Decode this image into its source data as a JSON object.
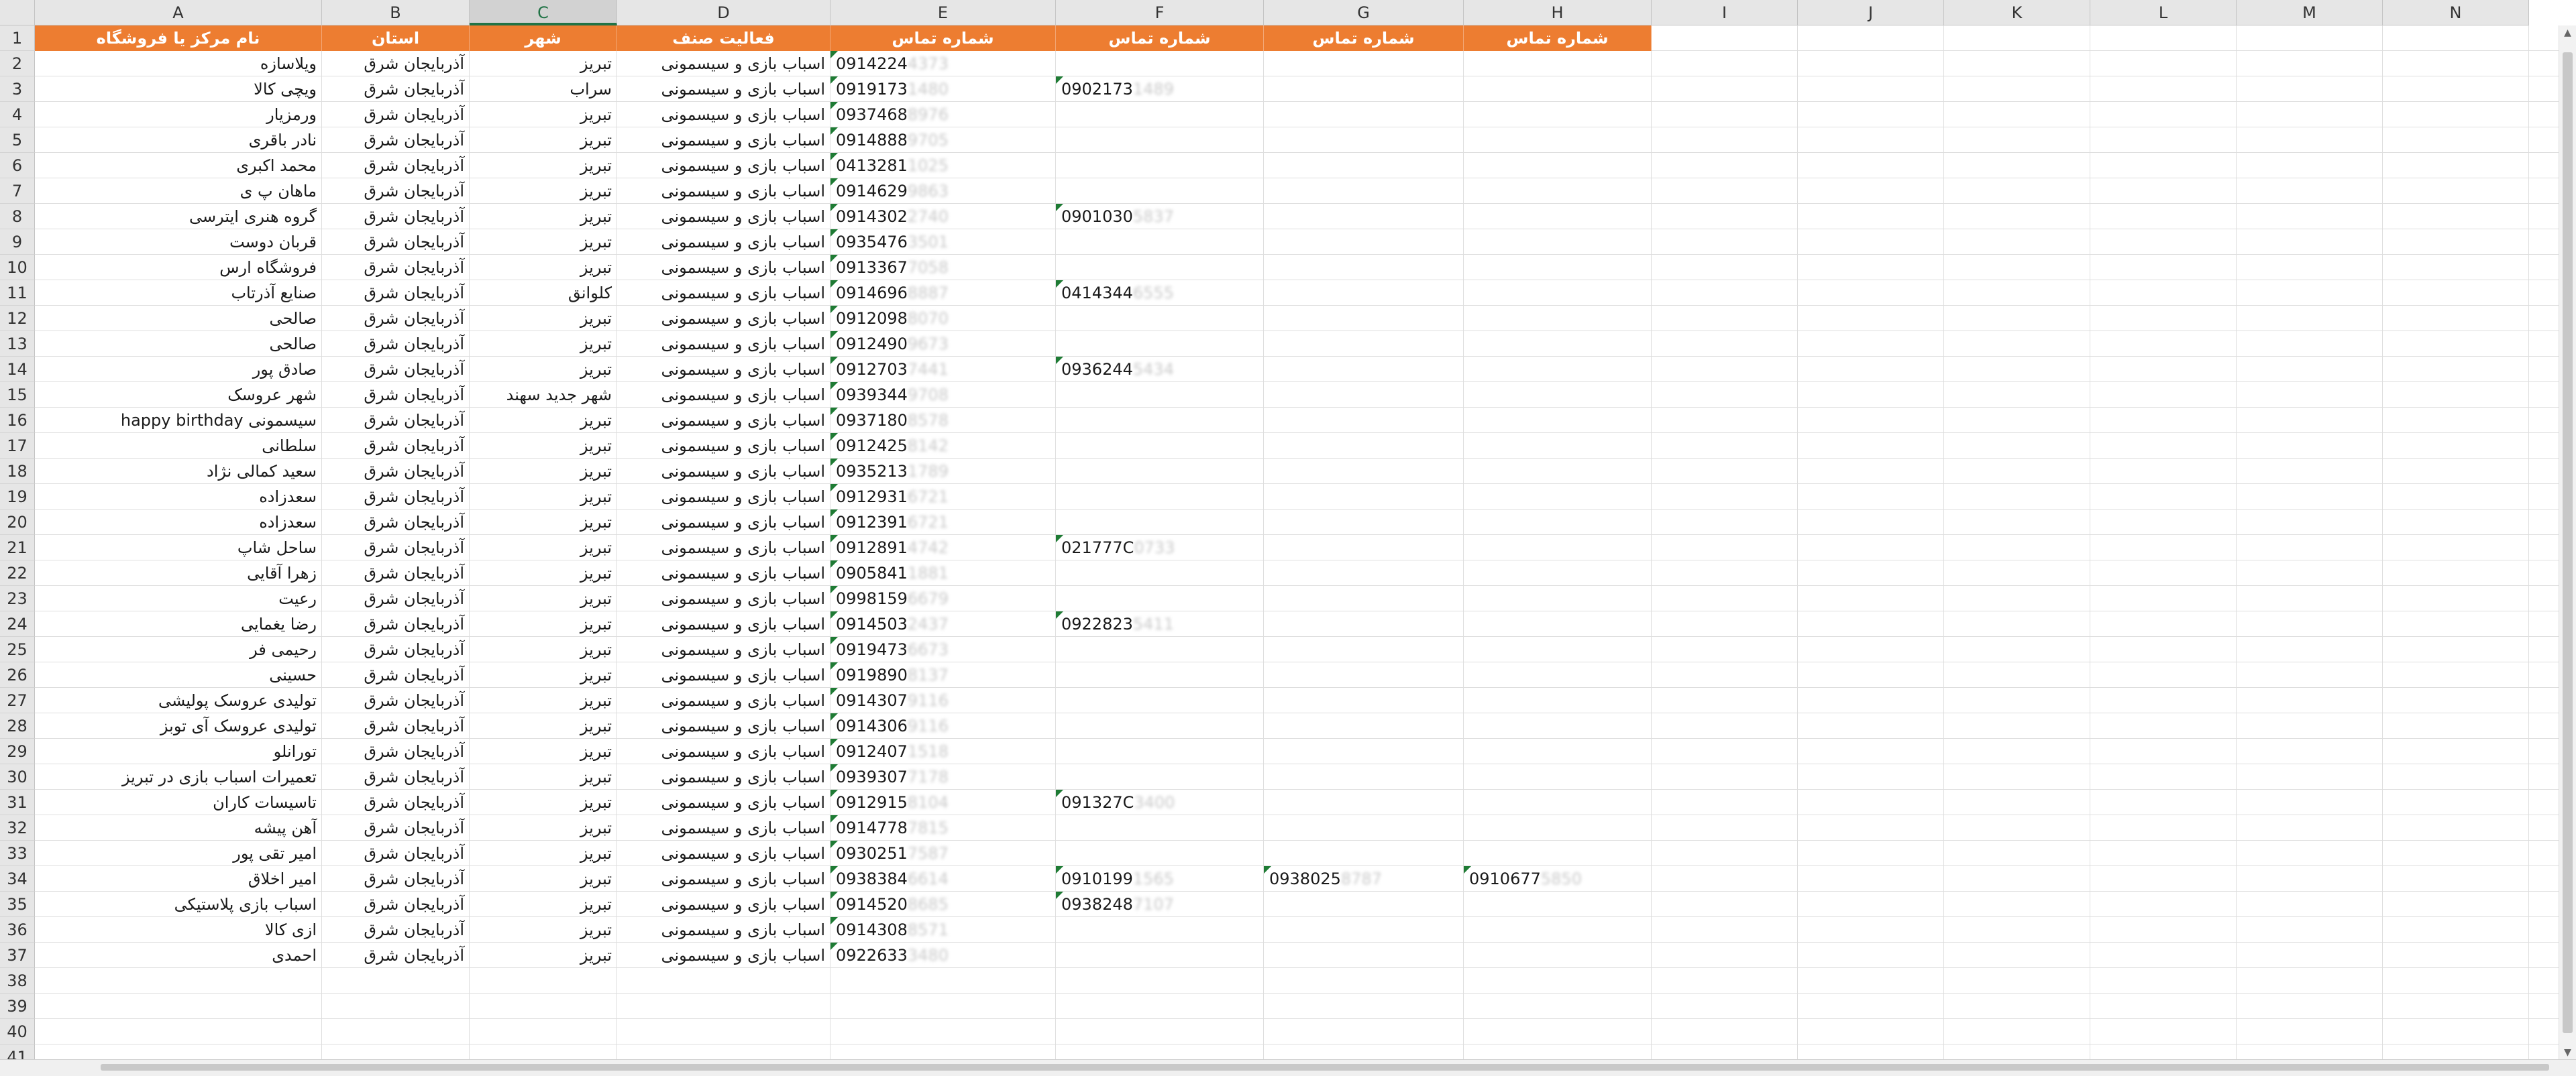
{
  "columns": [
    "A",
    "B",
    "C",
    "D",
    "E",
    "F",
    "G",
    "H",
    "I",
    "J",
    "K",
    "L",
    "M",
    "N"
  ],
  "selected_column": "C",
  "headers": {
    "A": "نام مرکز یا فروشگاه",
    "B": "استان",
    "C": "شهر",
    "D": "فعالیت صنف",
    "E": "شماره تماس",
    "F": "شماره تماس",
    "G": "شماره تماس",
    "H": "شماره تماس"
  },
  "header_fill_color": "#ed7d31",
  "row_numbers": [
    "1",
    "2",
    "3",
    "4",
    "5",
    "6",
    "7",
    "8",
    "9",
    "10",
    "11",
    "12",
    "13",
    "14",
    "15",
    "16",
    "17",
    "18",
    "19",
    "20",
    "21",
    "22",
    "23",
    "24",
    "25",
    "26",
    "27",
    "28",
    "29",
    "30",
    "31",
    "32",
    "33",
    "34",
    "35",
    "36",
    "37",
    "38",
    "39",
    "40",
    "41"
  ],
  "rows": [
    {
      "name": "ویلاسازه",
      "province": "آذربایجان شرق",
      "city": "تبریز",
      "activity": "اسباب بازی و سیسمونی",
      "e": {
        "v": "0914224",
        "b": "4373"
      }
    },
    {
      "name": "ویچی کالا",
      "province": "آذربایجان شرق",
      "city": "سراب",
      "activity": "اسباب بازی و سیسمونی",
      "e": {
        "v": "0919173",
        "b": "1480"
      },
      "f": {
        "v": "0902173",
        "b": "1489"
      }
    },
    {
      "name": "ورمزیار",
      "province": "آذربایجان شرق",
      "city": "تبریز",
      "activity": "اسباب بازی و سیسمونی",
      "e": {
        "v": "0937468",
        "b": "8976"
      }
    },
    {
      "name": "نادر باقری",
      "province": "آذربایجان شرق",
      "city": "تبریز",
      "activity": "اسباب بازی و سیسمونی",
      "e": {
        "v": "0914888",
        "b": "9705"
      }
    },
    {
      "name": "محمد اکبری",
      "province": "آذربایجان شرق",
      "city": "تبریز",
      "activity": "اسباب بازی و سیسمونی",
      "e": {
        "v": "0413281",
        "b": "1025"
      }
    },
    {
      "name": "ماهان پ ی",
      "province": "آذربایجان شرق",
      "city": "تبریز",
      "activity": "اسباب بازی و سیسمونی",
      "e": {
        "v": "0914629",
        "b": "9863"
      }
    },
    {
      "name": "گروه هنری ایترسی",
      "province": "آذربایجان شرق",
      "city": "تبریز",
      "activity": "اسباب بازی و سیسمونی",
      "e": {
        "v": "0914302",
        "b": "2740"
      },
      "f": {
        "v": "0901030",
        "b": "5837"
      }
    },
    {
      "name": "قربان دوست",
      "province": "آذربایجان شرق",
      "city": "تبریز",
      "activity": "اسباب بازی و سیسمونی",
      "e": {
        "v": "0935476",
        "b": "3501"
      }
    },
    {
      "name": "فروشگاه ارس",
      "province": "آذربایجان شرق",
      "city": "تبریز",
      "activity": "اسباب بازی و سیسمونی",
      "e": {
        "v": "0913367",
        "b": "7058"
      }
    },
    {
      "name": "صنایع آذرتاب",
      "province": "آذربایجان شرق",
      "city": "کلوانق",
      "activity": "اسباب بازی و سیسمونی",
      "e": {
        "v": "0914696",
        "b": "8887"
      },
      "f": {
        "v": "0414344",
        "b": "6555"
      }
    },
    {
      "name": "صالحی",
      "province": "آذربایجان شرق",
      "city": "تبریز",
      "activity": "اسباب بازی و سیسمونی",
      "e": {
        "v": "0912098",
        "b": "8070"
      }
    },
    {
      "name": "صالحی",
      "province": "آذربایجان شرق",
      "city": "تبریز",
      "activity": "اسباب بازی و سیسمونی",
      "e": {
        "v": "0912490",
        "b": "9673"
      }
    },
    {
      "name": "صادق پور",
      "province": "آذربایجان شرق",
      "city": "تبریز",
      "activity": "اسباب بازی و سیسمونی",
      "e": {
        "v": "0912703",
        "b": "7441"
      },
      "f": {
        "v": "0936244",
        "b": "5434"
      }
    },
    {
      "name": "شهر عروسک",
      "province": "آذربایجان شرق",
      "city": "شهر جدید سهند",
      "activity": "اسباب بازی و سیسمونی",
      "e": {
        "v": "0939344",
        "b": "9708"
      }
    },
    {
      "name": "سیسمونی happy birthday",
      "province": "آذربایجان شرق",
      "city": "تبریز",
      "activity": "اسباب بازی و سیسمونی",
      "e": {
        "v": "0937180",
        "b": "8578"
      }
    },
    {
      "name": "سلطانی",
      "province": "آذربایجان شرق",
      "city": "تبریز",
      "activity": "اسباب بازی و سیسمونی",
      "e": {
        "v": "0912425",
        "b": "8142"
      }
    },
    {
      "name": "سعید کمالی نژاد",
      "province": "آذربایجان شرق",
      "city": "تبریز",
      "activity": "اسباب بازی و سیسمونی",
      "e": {
        "v": "0935213",
        "b": "1789"
      }
    },
    {
      "name": "سعدزاده",
      "province": "آذربایجان شرق",
      "city": "تبریز",
      "activity": "اسباب بازی و سیسمونی",
      "e": {
        "v": "0912931",
        "b": "6721"
      }
    },
    {
      "name": "سعدزاده",
      "province": "آذربایجان شرق",
      "city": "تبریز",
      "activity": "اسباب بازی و سیسمونی",
      "e": {
        "v": "0912391",
        "b": "6721"
      }
    },
    {
      "name": "ساحل شاپ",
      "province": "آذربایجان شرق",
      "city": "تبریز",
      "activity": "اسباب بازی و سیسمونی",
      "e": {
        "v": "0912891",
        "b": "4742"
      },
      "f": {
        "v": "021777C",
        "b": "0733"
      }
    },
    {
      "name": "زهرا آقایی",
      "province": "آذربایجان شرق",
      "city": "تبریز",
      "activity": "اسباب بازی و سیسمونی",
      "e": {
        "v": "0905841",
        "b": "1881"
      }
    },
    {
      "name": "رعیت",
      "province": "آذربایجان شرق",
      "city": "تبریز",
      "activity": "اسباب بازی و سیسمونی",
      "e": {
        "v": "0998159",
        "b": "6679"
      }
    },
    {
      "name": "رضا یغمایی",
      "province": "آذربایجان شرق",
      "city": "تبریز",
      "activity": "اسباب بازی و سیسمونی",
      "e": {
        "v": "0914503",
        "b": "2437"
      },
      "f": {
        "v": "0922823",
        "b": "5411"
      }
    },
    {
      "name": "رحیمی فر",
      "province": "آذربایجان شرق",
      "city": "تبریز",
      "activity": "اسباب بازی و سیسمونی",
      "e": {
        "v": "0919473",
        "b": "6673"
      }
    },
    {
      "name": "حسینی",
      "province": "آذربایجان شرق",
      "city": "تبریز",
      "activity": "اسباب بازی و سیسمونی",
      "e": {
        "v": "0919890",
        "b": "8137"
      }
    },
    {
      "name": "تولیدی عروسک پولیشی",
      "province": "آذربایجان شرق",
      "city": "تبریز",
      "activity": "اسباب بازی و سیسمونی",
      "e": {
        "v": "0914307",
        "b": "9116"
      }
    },
    {
      "name": "تولیدی عروسک آی توبز",
      "province": "آذربایجان شرق",
      "city": "تبریز",
      "activity": "اسباب بازی و سیسمونی",
      "e": {
        "v": "0914306",
        "b": "9116"
      }
    },
    {
      "name": "تورانلو",
      "province": "آذربایجان شرق",
      "city": "تبریز",
      "activity": "اسباب بازی و سیسمونی",
      "e": {
        "v": "0912407",
        "b": "1518"
      }
    },
    {
      "name": "تعمیرات اسباب بازی در تبریز",
      "province": "آذربایجان شرق",
      "city": "تبریز",
      "activity": "اسباب بازی و سیسمونی",
      "e": {
        "v": "0939307",
        "b": "7178"
      }
    },
    {
      "name": "تاسیسات کاران",
      "province": "آذربایجان شرق",
      "city": "تبریز",
      "activity": "اسباب بازی و سیسمونی",
      "e": {
        "v": "0912915",
        "b": "8104"
      },
      "f": {
        "v": "091327C",
        "b": "3400"
      }
    },
    {
      "name": "آهن پیشه",
      "province": "آذربایجان شرق",
      "city": "تبریز",
      "activity": "اسباب بازی و سیسمونی",
      "e": {
        "v": "0914778",
        "b": "7815"
      }
    },
    {
      "name": "امیر تقی پور",
      "province": "آذربایجان شرق",
      "city": "تبریز",
      "activity": "اسباب بازی و سیسمونی",
      "e": {
        "v": "0930251",
        "b": "7587"
      }
    },
    {
      "name": "امیر اخلاق",
      "province": "آذربایجان شرق",
      "city": "تبریز",
      "activity": "اسباب بازی و سیسمونی",
      "e": {
        "v": "0938384",
        "b": "6614"
      },
      "f": {
        "v": "0910199",
        "b": "1565"
      },
      "g": {
        "v": "0938025",
        "b": "8787"
      },
      "h": {
        "v": "0910677",
        "b": "5850"
      }
    },
    {
      "name": "اسباب بازی پلاستیکی",
      "province": "آذربایجان شرق",
      "city": "تبریز",
      "activity": "اسباب بازی و سیسمونی",
      "e": {
        "v": "0914520",
        "b": "8685"
      },
      "f": {
        "v": "0938248",
        "b": "7107"
      }
    },
    {
      "name": "ازی کالا",
      "province": "آذربایجان شرق",
      "city": "تبریز",
      "activity": "اسباب بازی و سیسمونی",
      "e": {
        "v": "0914308",
        "b": "8571"
      }
    },
    {
      "name": "احمدی",
      "province": "آذربایجان شرق",
      "city": "تبریز",
      "activity": "اسباب بازی و سیسمونی",
      "e": {
        "v": "0922633",
        "b": "3480"
      }
    }
  ]
}
